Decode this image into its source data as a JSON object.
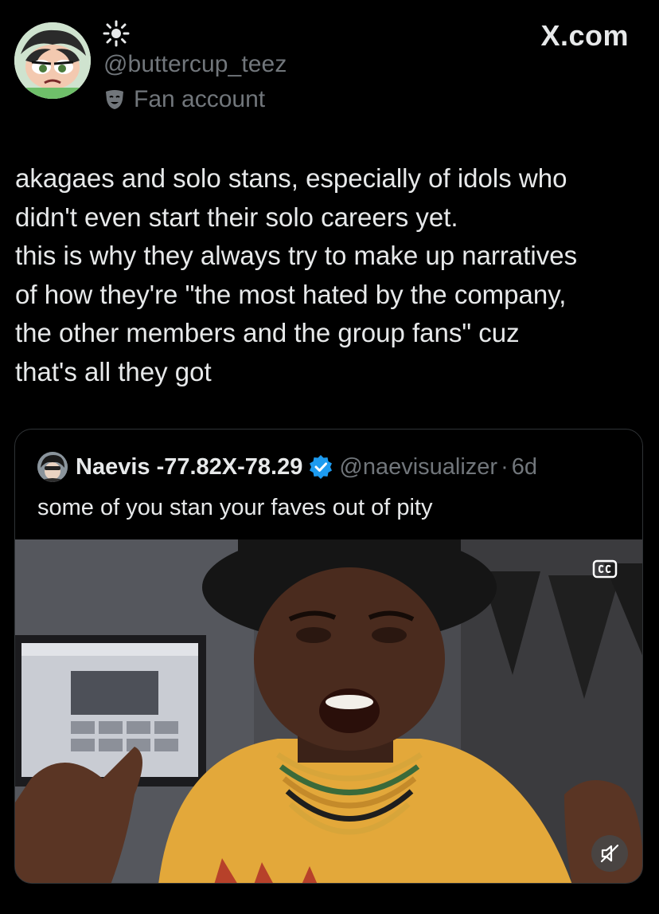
{
  "header": {
    "handle": "@buttercup_teez",
    "account_label": "Fan account",
    "brand": "X.com",
    "avatar_icon": "cartoon-avatar",
    "status_icon": "sun-icon",
    "label_icon": "theater-mask-icon"
  },
  "tweet": {
    "text": "akagaes and solo stans, especially of idols who\ndidn't even start their solo careers yet.\nthis is why they always try to make up narratives\nof how they're \"the most hated by the company,\nthe other members and the group fans\" cuz\nthat's all they got"
  },
  "quote": {
    "name": "Naevis -77.82X-78.29",
    "handle": "@naevisualizer",
    "separator": "·",
    "time": "6d",
    "text": "some of you stan your faves out of pity",
    "verified_color": "#1d9bf0",
    "media": {
      "captions_icon": "cc-icon",
      "sound_icon": "muted-speaker-icon"
    }
  },
  "colors": {
    "background": "#000000",
    "primary_text": "#e7e9ea",
    "secondary_text": "#71767b",
    "border": "#2f3336"
  }
}
